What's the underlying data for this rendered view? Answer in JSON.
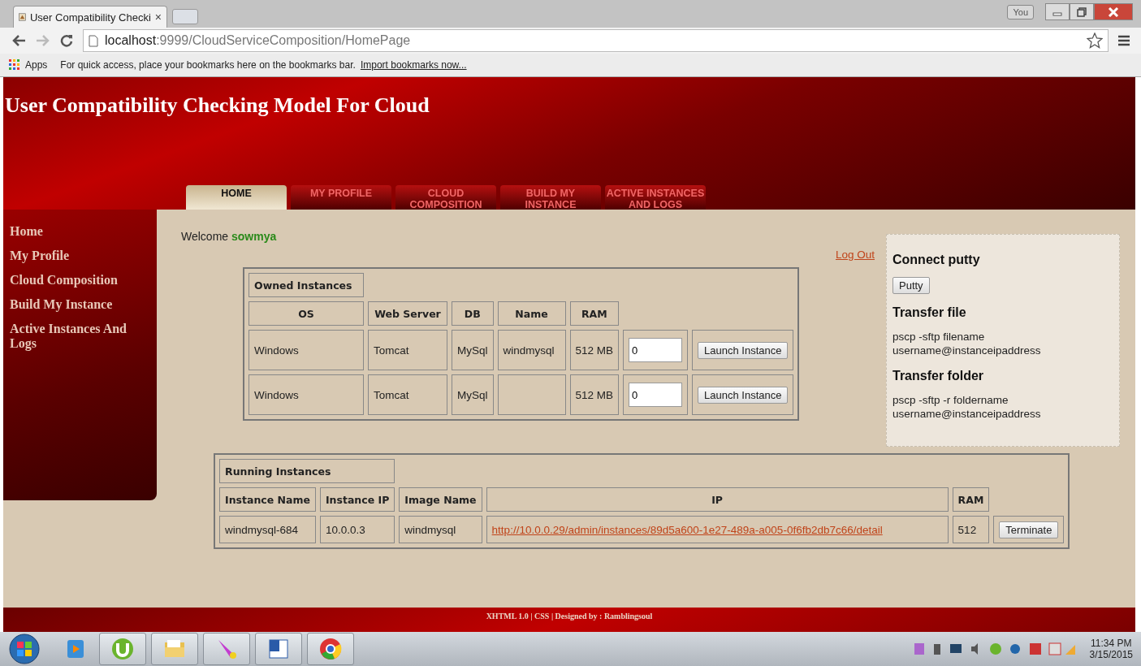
{
  "browser": {
    "tabs": [
      {
        "title": "User Compatibility Checki",
        "close": "×",
        "selected": true
      }
    ],
    "profile": "You",
    "address": {
      "host": "localhost",
      "path": ":9999/CloudServiceComposition/HomePage"
    },
    "bookmarks_bar": {
      "apps": "Apps",
      "hint": "For quick access, place your bookmarks here on the bookmarks bar.",
      "link": "Import bookmarks now..."
    }
  },
  "page": {
    "title": "User Compatibility Checking Model For Cloud",
    "nav_tabs": [
      {
        "label": "HOME",
        "selected": true
      },
      {
        "label": "MY PROFILE",
        "selected": false
      },
      {
        "label": "CLOUD COMPOSITION",
        "selected": false
      },
      {
        "label": "BUILD MY INSTANCE",
        "selected": false
      },
      {
        "label": "ACTIVE INSTANCES AND LOGS",
        "selected": false
      }
    ],
    "sidebar": {
      "items": [
        "Home",
        "My Profile",
        "Cloud Composition",
        "Build My Instance",
        "Active Instances And Logs"
      ]
    },
    "welcome": {
      "label": "Welcome",
      "user": "sowmya"
    },
    "logout": "Log Out",
    "owned_instances": {
      "title": "Owned Instances",
      "columns": [
        "OS",
        "Web Server",
        "DB",
        "Name",
        "RAM"
      ],
      "rows": [
        {
          "os": "Windows",
          "web_server": "Tomcat",
          "db": "MySql",
          "name": "windmysql",
          "ram": "512 MB",
          "count": "0",
          "action": "Launch Instance"
        },
        {
          "os": "Windows",
          "web_server": "Tomcat",
          "db": "MySql",
          "name": "",
          "ram": "512 MB",
          "count": "0",
          "action": "Launch Instance"
        }
      ]
    },
    "running_instances": {
      "title": "Running Instances",
      "columns": [
        "Instance Name",
        "Instance IP",
        "Image Name",
        "IP",
        "RAM"
      ],
      "rows": [
        {
          "instance_name": "windmysql-684",
          "instance_ip": "10.0.0.3",
          "image_name": "windmysql",
          "ip": "http://10.0.0.29/admin/instances/89d5a600-1e27-489a-a005-0f6fb2db7c66/detail",
          "ram": "512",
          "action": "Terminate"
        }
      ]
    },
    "help_panel": {
      "sections": [
        {
          "heading": "Connect putty",
          "kind": "button",
          "content": "Putty"
        },
        {
          "heading": "Transfer file",
          "kind": "text",
          "content": "pscp -sftp filename username@instanceipaddress"
        },
        {
          "heading": "Transfer folder",
          "kind": "text",
          "content": "pscp -sftp -r foldername username@instanceipaddress"
        }
      ]
    },
    "footer": "XHTML 1.0 | CSS | Designed by : Ramblingsoul"
  },
  "taskbar": {
    "time": "11:34 PM",
    "date": "3/15/2015"
  }
}
